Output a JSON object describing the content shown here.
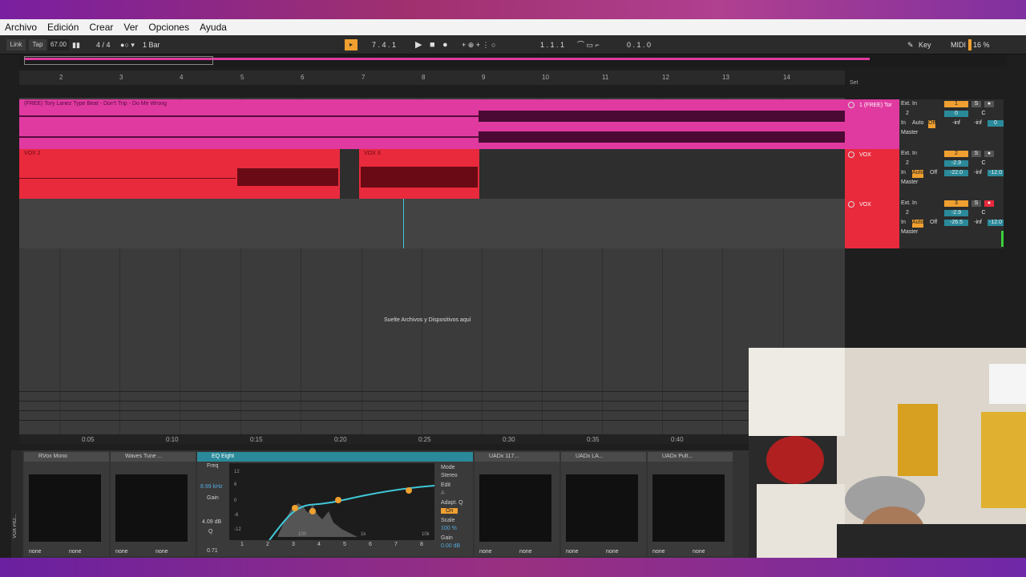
{
  "menu": [
    "Archivo",
    "Edición",
    "Crear",
    "Ver",
    "Opciones",
    "Ayuda"
  ],
  "transport": {
    "link": "Link",
    "tap": "Tap",
    "tempo": "67.00",
    "signature": "4 / 4",
    "quantize": "1 Bar",
    "position": "7 .  4 .  1",
    "loop_start": "1 .  1 .  1",
    "loop_length": "0 .  1 .  0",
    "key_label": "Key",
    "midi_label": "MIDI",
    "cpu": "16 %"
  },
  "ruler": {
    "bars": [
      "2",
      "3",
      "4",
      "5",
      "6",
      "7",
      "8",
      "9",
      "10",
      "11",
      "12",
      "13",
      "14"
    ],
    "set_label": "Set"
  },
  "timebar": [
    "0:05",
    "0:10",
    "0:15",
    "0:20",
    "0:25",
    "0:30",
    "0:35",
    "0:40"
  ],
  "tracks": [
    {
      "clip_title": "(FREE) Tory Lanez Type Beat - Don't Trip - Do Me Wrong",
      "name": "1 (FREE) Tor",
      "input": "Ext. In",
      "channel": "2",
      "monitor": [
        "In",
        "Auto",
        "Off"
      ],
      "out": "Master",
      "num": "1",
      "s": "S",
      "vol": "0",
      "pan": "C",
      "send_a": "-inf",
      "send_b": "-inf",
      "send_c": "0",
      "color": "#e03aa0"
    },
    {
      "clip_title": "VOX 2",
      "clip2_title": "VOX 3",
      "name": "VOX",
      "input": "Ext. In",
      "channel": "2",
      "monitor": [
        "In",
        "Auto",
        "Off"
      ],
      "out": "Master",
      "num": "2",
      "s": "S",
      "vol": "-2.9",
      "pan": "C",
      "send_a": "-22.0",
      "send_b": "-inf",
      "send_c": "-12.0",
      "color": "#e82a3c"
    },
    {
      "name": "VOX",
      "input": "Ext. In",
      "channel": "2",
      "monitor": [
        "In",
        "Auto",
        "Off"
      ],
      "out": "Master",
      "num": "3",
      "s": "S",
      "vol": "-2.9",
      "pan": "C",
      "send_a": "-26.5",
      "send_b": "-inf",
      "send_c": "-12.0",
      "color": "#e82a3c"
    }
  ],
  "drop_text": "Suelte Archivos y Dispositivos aquí",
  "devices": [
    {
      "title": "RVox Mono",
      "foot": [
        "none",
        "none"
      ]
    },
    {
      "title": "Waves Tune ...",
      "foot": [
        "none",
        "none"
      ]
    },
    {
      "title": "EQ Eight",
      "freq_label": "Freq",
      "freq": "8.99 kHz",
      "gain_label": "Gain",
      "gain": "4.09 dB",
      "q_label": "Q",
      "q": "0.71",
      "db_ticks": [
        "12",
        "6",
        "0",
        "-6",
        "-12"
      ],
      "freq_ticks": [
        "100",
        "1k",
        "10k"
      ],
      "bands": [
        "1",
        "2",
        "3",
        "4",
        "5",
        "6",
        "7",
        "8"
      ],
      "mode_label": "Mode",
      "mode": "Stereo",
      "edit_label": "Edit",
      "edit_val": "A",
      "adapt_label": "Adapt. Q",
      "adapt_val": "On",
      "scale_label": "Scale",
      "scale": "100 %",
      "out_gain_label": "Gain",
      "out_gain": "0.00 dB"
    },
    {
      "title": "UADx 117...",
      "foot": [
        "none",
        "none"
      ]
    },
    {
      "title": "UADx LA...",
      "foot": [
        "none",
        "none"
      ]
    },
    {
      "title": "UADx Pult...",
      "foot": [
        "none",
        "none"
      ]
    }
  ],
  "device_track_label": "VOX PIO...",
  "colors": {
    "accent": "#f0a030",
    "pink": "#e03aa0",
    "red": "#e82a3c",
    "cyan": "#40c8d8"
  }
}
